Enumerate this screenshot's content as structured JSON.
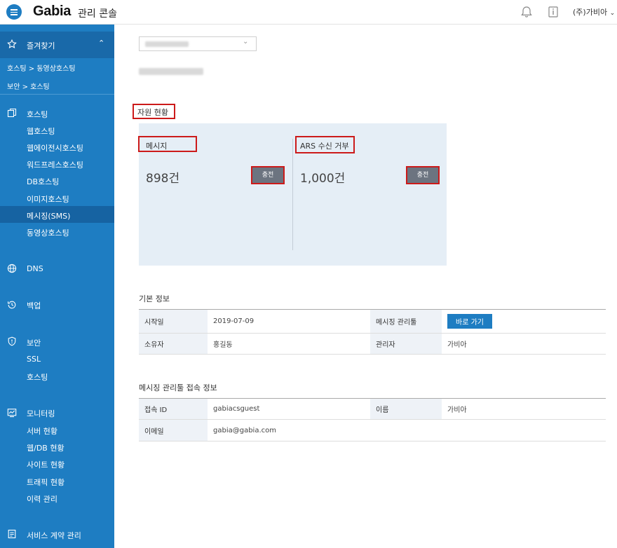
{
  "header": {
    "brand": "Gabia",
    "brand_sub": "관리 콘솔",
    "company": "(주)가비아"
  },
  "sidebar": {
    "favorites_label": "즐겨찾기",
    "favorite_links": [
      "호스팅 > 동영상호스팅",
      "보안 > 호스팅"
    ],
    "groups": {
      "hosting": {
        "label": "호스팅",
        "items": [
          "웹호스팅",
          "웹에이전시호스팅",
          "워드프레스호스팅",
          "DB호스팅",
          "이미지호스팅",
          "메시징(SMS)",
          "동영상호스팅"
        ]
      },
      "dns": {
        "label": "DNS"
      },
      "backup": {
        "label": "백업"
      },
      "security": {
        "label": "보안",
        "items": [
          "SSL",
          "호스팅"
        ]
      },
      "monitoring": {
        "label": "모니터링",
        "items": [
          "서버 현황",
          "웹/DB 현황",
          "사이트 현황",
          "트래픽 현황",
          "이력 관리"
        ]
      },
      "contract": {
        "label": "서비스 계약 관리"
      }
    }
  },
  "resources": {
    "title": "자원 현황",
    "message_label": "메시지",
    "message_value": "898건",
    "ars_label": "ARS 수신 거부",
    "ars_value": "1,000건",
    "charge_label": "충전"
  },
  "basic_info": {
    "title": "기본 정보",
    "start_date_label": "시작일",
    "start_date": "2019-07-09",
    "tool_label": "메시징 관리툴",
    "go_button": "바로 가기",
    "owner_label": "소유자",
    "owner": "홍길동",
    "manager_label": "관리자",
    "manager": "가비아"
  },
  "access_info": {
    "title": "메시징 관리툴 접속 정보",
    "id_label": "접속 ID",
    "id_value": "gabiacsguest",
    "name_label": "이름",
    "name_value": "가비아",
    "email_label": "이메일",
    "email_value": "gabia@gabia.com"
  },
  "colors": {
    "sidebar": "#1e7dc2",
    "highlight": "#cc1a1a",
    "panel": "#e5eef6"
  }
}
